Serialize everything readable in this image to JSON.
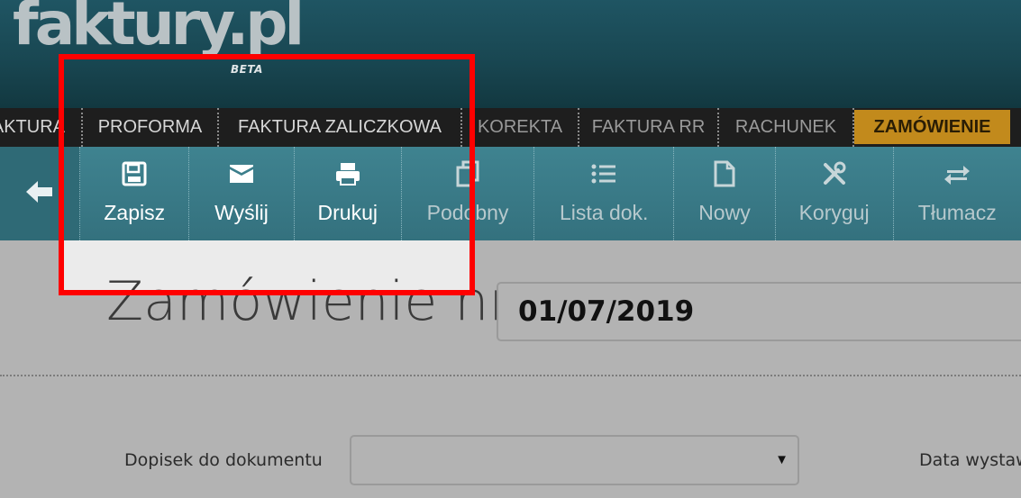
{
  "logo": {
    "text": "faktury.pl",
    "badge": "BETA"
  },
  "doc_types": [
    {
      "label": "AKTURA"
    },
    {
      "label": "PROFORMA"
    },
    {
      "label": "FAKTURA ZALICZKOWA"
    },
    {
      "label": "KOREKTA"
    },
    {
      "label": "FAKTURA RR"
    },
    {
      "label": "RACHUNEK"
    },
    {
      "label": "ZAMÓWIENIE"
    }
  ],
  "toolbar": {
    "back_icon": "arrow-left-icon",
    "buttons": [
      {
        "label": "Zapisz",
        "icon": "floppy-icon"
      },
      {
        "label": "Wyślij",
        "icon": "envelope-icon"
      },
      {
        "label": "Drukuj",
        "icon": "printer-icon"
      },
      {
        "label": "Podobny",
        "icon": "copy-icon"
      },
      {
        "label": "Lista dok.",
        "icon": "list-icon"
      },
      {
        "label": "Nowy",
        "icon": "new-document-icon"
      },
      {
        "label": "Koryguj",
        "icon": "tools-icon"
      },
      {
        "label": "Tłumacz",
        "icon": "swap-icon"
      }
    ]
  },
  "document": {
    "title": "Zamówienie nr",
    "number": "01/07/2019"
  },
  "form": {
    "note_label": "Dopisek do dokumentu",
    "note_value": "",
    "date_label": "Data wystaw"
  },
  "colors": {
    "accent": "#c28a1c",
    "toolbar": "#3a7a87",
    "highlight_box": "#ff0000"
  }
}
